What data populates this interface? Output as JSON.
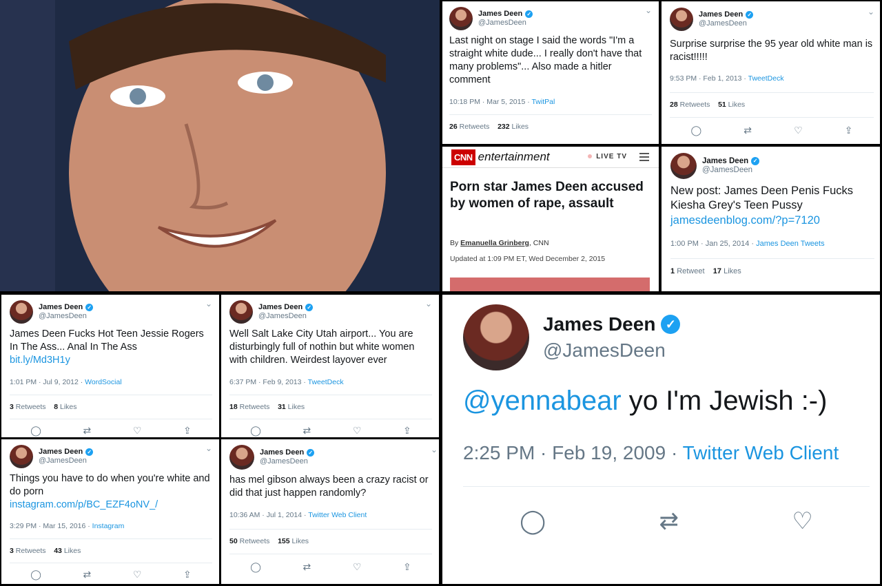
{
  "photo": {
    "alt": ""
  },
  "tweets": {
    "t1": {
      "name": "James Deen",
      "handle": "@JamesDeen",
      "text": "Last night on stage I said the words \"I'm a straight white dude... I really don't have that many problems\"... Also made a hitler comment",
      "time": "10:18 PM · Mar 5, 2015",
      "source": "TwitPal",
      "retweets": "26",
      "retweets_label": "Retweets",
      "likes": "232",
      "likes_label": "Likes"
    },
    "t2": {
      "name": "James Deen",
      "handle": "@JamesDeen",
      "text": "Surprise surprise the 95 year old white man is racist!!!!!",
      "time": "9:53 PM · Feb 1, 2013",
      "source": "TweetDeck",
      "retweets": "28",
      "retweets_label": "Retweets",
      "likes": "51",
      "likes_label": "Likes"
    },
    "t3": {
      "name": "James Deen",
      "handle": "@JamesDeen",
      "text": "New post: James Deen Penis Fucks Kiesha Grey's Teen Pussy",
      "link": "jamesdeenblog.com/?p=7120",
      "time": "1:00 PM · Jan 25, 2014",
      "source": "James Deen Tweets",
      "retweets": "1",
      "retweets_label": "Retweet",
      "likes": "17",
      "likes_label": "Likes"
    },
    "t4": {
      "name": "James Deen",
      "handle": "@JamesDeen",
      "text": "James Deen Fucks Hot Teen Jessie Rogers In The Ass... Anal In The Ass",
      "link": "bit.ly/Md3H1y",
      "time": "1:01 PM · Jul 9, 2012",
      "source": "WordSocial",
      "retweets": "3",
      "retweets_label": "Retweets",
      "likes": "8",
      "likes_label": "Likes"
    },
    "t5": {
      "name": "James Deen",
      "handle": "@JamesDeen",
      "text": "Well Salt Lake City Utah airport... You are disturbingly full of nothin but white women with children.  Weirdest layover ever",
      "time": "6:37 PM · Feb 9, 2013",
      "source": "TweetDeck",
      "retweets": "18",
      "retweets_label": "Retweets",
      "likes": "31",
      "likes_label": "Likes"
    },
    "t6": {
      "name": "James Deen",
      "handle": "@JamesDeen",
      "text": "Things you have to do when you're white and do porn",
      "link": "instagram.com/p/BC_EZF4oNV_/",
      "time": "3:29 PM · Mar 15, 2016",
      "source": "Instagram",
      "retweets": "3",
      "retweets_label": "Retweets",
      "likes": "43",
      "likes_label": "Likes"
    },
    "t7": {
      "name": "James Deen",
      "handle": "@JamesDeen",
      "text": "has mel gibson always been a crazy racist or did that just happen randomly?",
      "time": "10:36 AM · Jul 1, 2014",
      "source": "Twitter Web Client",
      "retweets": "50",
      "retweets_label": "Retweets",
      "likes": "155",
      "likes_label": "Likes"
    },
    "t8": {
      "name": "James Deen",
      "handle": "@JamesDeen",
      "mention": "@yennabear",
      "text": " yo I'm Jewish :-)",
      "time": "2:25 PM · Feb 19, 2009 · ",
      "source": "Twitter Web Client"
    }
  },
  "cnn": {
    "logo": "CNN",
    "section": "entertainment",
    "live": "LIVE TV",
    "headline": "Porn star James Deen accused by women of rape, assault",
    "by": "By ",
    "author": "Emanuella Grinberg",
    "outlet": ", CNN",
    "updated": "Updated at 1:09 PM ET, Wed December 2, 2015"
  },
  "icons": {
    "verified": "verified-badge-icon",
    "reply": "reply-icon",
    "retweet": "retweet-icon",
    "like": "heart-icon",
    "share": "share-icon",
    "chevron": "chevron-down-icon"
  },
  "colors": {
    "link": "#1b95e0",
    "badge": "#1da1f2",
    "cnn": "#cc0000"
  }
}
